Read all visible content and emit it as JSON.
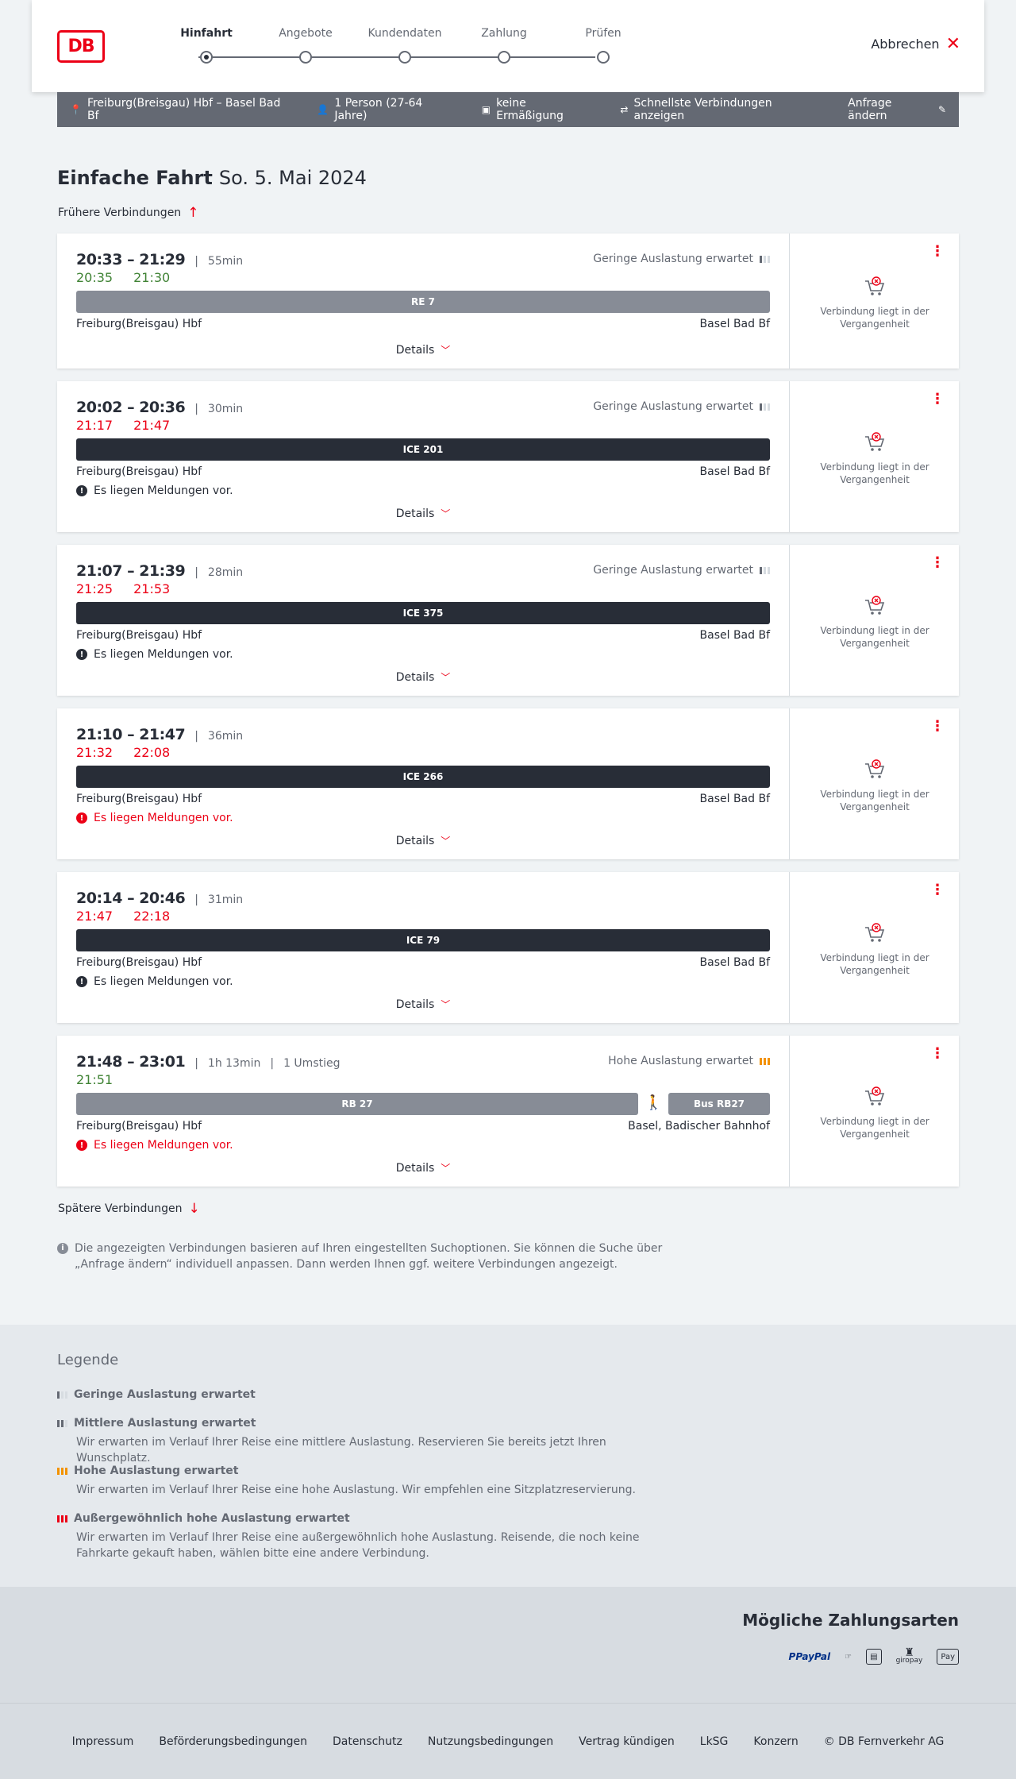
{
  "header": {
    "logo_text": "DB",
    "steps": [
      "Hinfahrt",
      "Angebote",
      "Kundendaten",
      "Zahlung",
      "Prüfen"
    ],
    "cancel_label": "Abbrechen"
  },
  "summary": {
    "route": "Freiburg(Breisgau) Hbf – Basel Bad Bf",
    "persons": "1 Person (27-64 Jahre)",
    "discount": "keine Ermäßigung",
    "fastest": "Schnellste Verbindungen anzeigen",
    "edit": "Anfrage ändern"
  },
  "page": {
    "title": "Einfache Fahrt",
    "date": "So. 5. Mai 2024",
    "earlier": "Frühere Verbindungen",
    "later": "Spätere Verbindungen",
    "info": "Die angezeigten Verbindungen basieren auf Ihren eingestellten Suchoptionen. Sie können die Suche über „Anfrage ändern“ individuell anpassen. Dann werden Ihnen ggf. weitere Verbindungen angezeigt."
  },
  "connection_common": {
    "details": "Details",
    "past_text": "Verbindung liegt in der Vergangenheit"
  },
  "connections": [
    {
      "time": "20:33 – 21:29",
      "duration": "55min",
      "occupancy": "Geringe Auslastung erwartet",
      "rt_dep": "20:35",
      "rt_arr": "21:30",
      "train": "RE 7",
      "from": "Freiburg(Breisgau) Hbf",
      "to": "Basel Bad Bf"
    },
    {
      "time": "20:02 – 20:36",
      "duration": "30min",
      "occupancy": "Geringe Auslastung erwartet",
      "rt_dep": "21:17",
      "rt_arr": "21:47",
      "train": "ICE 201",
      "from": "Freiburg(Breisgau) Hbf",
      "to": "Basel Bad Bf",
      "message": "Es liegen Meldungen vor."
    },
    {
      "time": "21:07 – 21:39",
      "duration": "28min",
      "occupancy": "Geringe Auslastung erwartet",
      "rt_dep": "21:25",
      "rt_arr": "21:53",
      "train": "ICE 375",
      "from": "Freiburg(Breisgau) Hbf",
      "to": "Basel Bad Bf",
      "message": "Es liegen Meldungen vor."
    },
    {
      "time": "21:10 – 21:47",
      "duration": "36min",
      "rt_dep": "21:32",
      "rt_arr": "22:08",
      "train": "ICE 266",
      "from": "Freiburg(Breisgau) Hbf",
      "to": "Basel Bad Bf",
      "message": "Es liegen Meldungen vor."
    },
    {
      "time": "20:14 – 20:46",
      "duration": "31min",
      "rt_dep": "21:47",
      "rt_arr": "22:18",
      "train": "ICE 79",
      "from": "Freiburg(Breisgau) Hbf",
      "to": "Basel Bad Bf",
      "message": "Es liegen Meldungen vor."
    },
    {
      "time": "21:48 – 23:01",
      "duration": "1h 13min",
      "transfers": "1 Umstieg",
      "occupancy": "Hohe Auslastung erwartet",
      "rt_dep": "21:51",
      "train": "RB 27",
      "train2": "Bus RB27",
      "from": "Freiburg(Breisgau) Hbf",
      "to": "Basel, Badischer Bahnhof",
      "message": "Es liegen Meldungen vor."
    }
  ],
  "legend": {
    "title": "Legende",
    "items": [
      {
        "title": "Geringe Auslastung erwartet"
      },
      {
        "title": "Mittlere Auslastung erwartet",
        "text": "Wir erwarten im Verlauf Ihrer Reise eine mittlere Auslastung. Reservieren Sie bereits jetzt Ihren Wunschplatz."
      },
      {
        "title": "Hohe Auslastung erwartet",
        "text": "Wir erwarten im Verlauf Ihrer Reise eine hohe Auslastung. Wir empfehlen eine Sitzplatzreservierung."
      },
      {
        "title": "Außergewöhnlich hohe Auslastung erwartet",
        "text": "Wir erwarten im Verlauf Ihrer Reise eine außergewöhnlich hohe Auslastung. Reisende, die noch keine Fahrkarte gekauft haben, wählen bitte eine andere Verbindung."
      }
    ]
  },
  "payment": {
    "title": "Mögliche Zahlungsarten",
    "methods": [
      "PayPal",
      "giropay",
      "Pay"
    ]
  },
  "footer": {
    "links": [
      "Impressum",
      "Beförderungsbedingungen",
      "Datenschutz",
      "Nutzungsbedingungen",
      "Vertrag kündigen",
      "LkSG",
      "Konzern",
      "© DB Fernverkehr AG"
    ]
  },
  "colors": {
    "accent": "#ec0016",
    "ontime": "#408335",
    "summary_bg": "#646973",
    "occupancy_high": "#f39200"
  }
}
